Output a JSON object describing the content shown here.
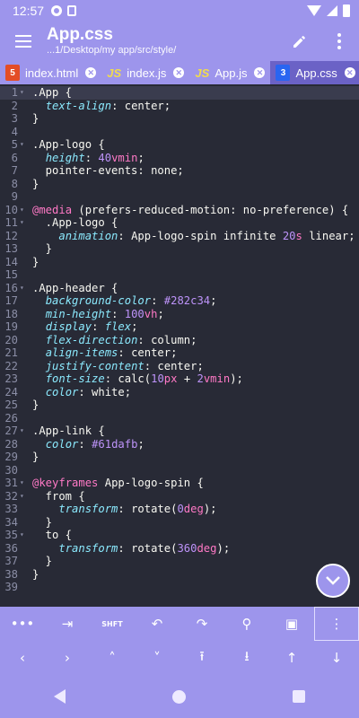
{
  "status": {
    "time": "12:57"
  },
  "appbar": {
    "title": "App.css",
    "subtitle": "...1/Desktop/my app/src/style/",
    "menu_icon": "hamburger-icon",
    "edit_icon": "pencil-icon",
    "more_icon": "kebab-icon"
  },
  "tabs": [
    {
      "label": "index.html",
      "icon": "HTML5",
      "type": "html"
    },
    {
      "label": "index.js",
      "icon": "JS",
      "type": "js"
    },
    {
      "label": "App.js",
      "icon": "JS",
      "type": "js"
    },
    {
      "label": "App.css",
      "icon": "CSS3",
      "type": "css",
      "active": true
    }
  ],
  "editor": {
    "lines": [
      [
        {
          "t": ".App {",
          "c": "sel"
        }
      ],
      [
        {
          "t": "  "
        },
        {
          "t": "text-align",
          "c": "prop"
        },
        {
          "t": ": center;"
        }
      ],
      [
        {
          "t": "}"
        }
      ],
      [],
      [
        {
          "t": ".App-logo {"
        }
      ],
      [
        {
          "t": "  "
        },
        {
          "t": "height",
          "c": "prop"
        },
        {
          "t": ": "
        },
        {
          "t": "40",
          "c": "num"
        },
        {
          "t": "vmin",
          "c": "unit"
        },
        {
          "t": ";"
        }
      ],
      [
        {
          "t": "  pointer-events: none;"
        }
      ],
      [
        {
          "t": "}"
        }
      ],
      [],
      [
        {
          "t": "@",
          "c": "at"
        },
        {
          "t": "media",
          "c": "at"
        },
        {
          "t": " (prefers-reduced-motion: no-preference) {"
        }
      ],
      [
        {
          "t": "  .App-logo {"
        }
      ],
      [
        {
          "t": "    "
        },
        {
          "t": "animation",
          "c": "prop"
        },
        {
          "t": ": App-logo-spin infinite "
        },
        {
          "t": "20",
          "c": "num"
        },
        {
          "t": "s",
          "c": "unit"
        },
        {
          "t": " linear;"
        }
      ],
      [
        {
          "t": "  }"
        }
      ],
      [
        {
          "t": "}"
        }
      ],
      [],
      [
        {
          "t": ".App-header {"
        }
      ],
      [
        {
          "t": "  "
        },
        {
          "t": "background-color",
          "c": "prop"
        },
        {
          "t": ": "
        },
        {
          "t": "#282c34",
          "c": "num"
        },
        {
          "t": ";"
        }
      ],
      [
        {
          "t": "  "
        },
        {
          "t": "min-height",
          "c": "prop"
        },
        {
          "t": ": "
        },
        {
          "t": "100",
          "c": "num"
        },
        {
          "t": "vh",
          "c": "unit"
        },
        {
          "t": ";"
        }
      ],
      [
        {
          "t": "  "
        },
        {
          "t": "display",
          "c": "prop"
        },
        {
          "t": ": "
        },
        {
          "t": "flex",
          "c": "prop"
        },
        {
          "t": ";"
        }
      ],
      [
        {
          "t": "  "
        },
        {
          "t": "flex-direction",
          "c": "prop"
        },
        {
          "t": ": column;"
        }
      ],
      [
        {
          "t": "  "
        },
        {
          "t": "align-items",
          "c": "prop"
        },
        {
          "t": ": center;"
        }
      ],
      [
        {
          "t": "  "
        },
        {
          "t": "justify-content",
          "c": "prop"
        },
        {
          "t": ": center;"
        }
      ],
      [
        {
          "t": "  "
        },
        {
          "t": "font-size",
          "c": "prop"
        },
        {
          "t": ": calc("
        },
        {
          "t": "10",
          "c": "num"
        },
        {
          "t": "px",
          "c": "unit"
        },
        {
          "t": " + "
        },
        {
          "t": "2",
          "c": "num"
        },
        {
          "t": "vmin",
          "c": "unit"
        },
        {
          "t": ");"
        }
      ],
      [
        {
          "t": "  "
        },
        {
          "t": "color",
          "c": "prop"
        },
        {
          "t": ": white;"
        }
      ],
      [
        {
          "t": "}"
        }
      ],
      [],
      [
        {
          "t": ".App-link {"
        }
      ],
      [
        {
          "t": "  "
        },
        {
          "t": "color",
          "c": "prop"
        },
        {
          "t": ": "
        },
        {
          "t": "#61dafb",
          "c": "num"
        },
        {
          "t": ";"
        }
      ],
      [
        {
          "t": "}"
        }
      ],
      [],
      [
        {
          "t": "@",
          "c": "at"
        },
        {
          "t": "keyframes",
          "c": "at"
        },
        {
          "t": " App-logo-spin {"
        }
      ],
      [
        {
          "t": "  from {"
        }
      ],
      [
        {
          "t": "    "
        },
        {
          "t": "transform",
          "c": "prop"
        },
        {
          "t": ": rotate("
        },
        {
          "t": "0",
          "c": "num"
        },
        {
          "t": "deg",
          "c": "unit"
        },
        {
          "t": ");"
        }
      ],
      [
        {
          "t": "  }"
        }
      ],
      [
        {
          "t": "  to {"
        }
      ],
      [
        {
          "t": "    "
        },
        {
          "t": "transform",
          "c": "prop"
        },
        {
          "t": ": rotate("
        },
        {
          "t": "360",
          "c": "num"
        },
        {
          "t": "deg",
          "c": "unit"
        },
        {
          "t": ");"
        }
      ],
      [
        {
          "t": "  }"
        }
      ],
      [
        {
          "t": "}"
        }
      ],
      []
    ],
    "fold_lines": [
      1,
      5,
      10,
      11,
      16,
      27,
      31,
      32,
      35
    ]
  },
  "toolbar1": [
    {
      "name": "more-tools-button",
      "glyph": "•••"
    },
    {
      "name": "tab-key-button",
      "glyph": "⇥"
    },
    {
      "name": "shift-button",
      "glyph": "SHFT",
      "small": true
    },
    {
      "name": "undo-button",
      "glyph": "↶"
    },
    {
      "name": "redo-button",
      "glyph": "↷"
    },
    {
      "name": "search-button",
      "glyph": "⚲"
    },
    {
      "name": "save-button",
      "glyph": "▣"
    },
    {
      "name": "overflow-menu-button",
      "glyph": "⋮",
      "boxed": true
    }
  ],
  "toolbar2": [
    {
      "name": "cursor-left-button",
      "glyph": "‹"
    },
    {
      "name": "cursor-right-button",
      "glyph": "›"
    },
    {
      "name": "cursor-up-button",
      "glyph": "˄"
    },
    {
      "name": "cursor-down-button",
      "glyph": "˅"
    },
    {
      "name": "page-up-button",
      "glyph": "⭱"
    },
    {
      "name": "page-down-button",
      "glyph": "⭳"
    },
    {
      "name": "doc-start-button",
      "glyph": "↑"
    },
    {
      "name": "doc-end-button",
      "glyph": "↓"
    }
  ],
  "fab": {
    "icon": "chevron-down-icon",
    "glyph": "⌄"
  }
}
